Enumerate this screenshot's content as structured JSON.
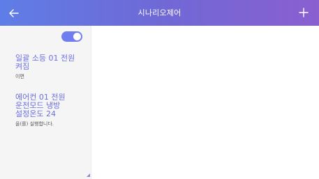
{
  "header": {
    "title": "시나리오제어",
    "back_icon": "arrow-left-icon",
    "add_icon": "plus-icon",
    "gradient_colors": [
      "#5f7de6",
      "#8a5fd0"
    ]
  },
  "scenario": {
    "enabled": true,
    "toggle_color": "#6f7df0",
    "steps": [
      {
        "command": "일괄 소등 01 전원\n켜짐",
        "suffix": "이면"
      },
      {
        "command": "에어컨 01 전원\n운전모드 냉방\n설정온도 24",
        "suffix": "을(를) 실행합니다."
      }
    ]
  }
}
